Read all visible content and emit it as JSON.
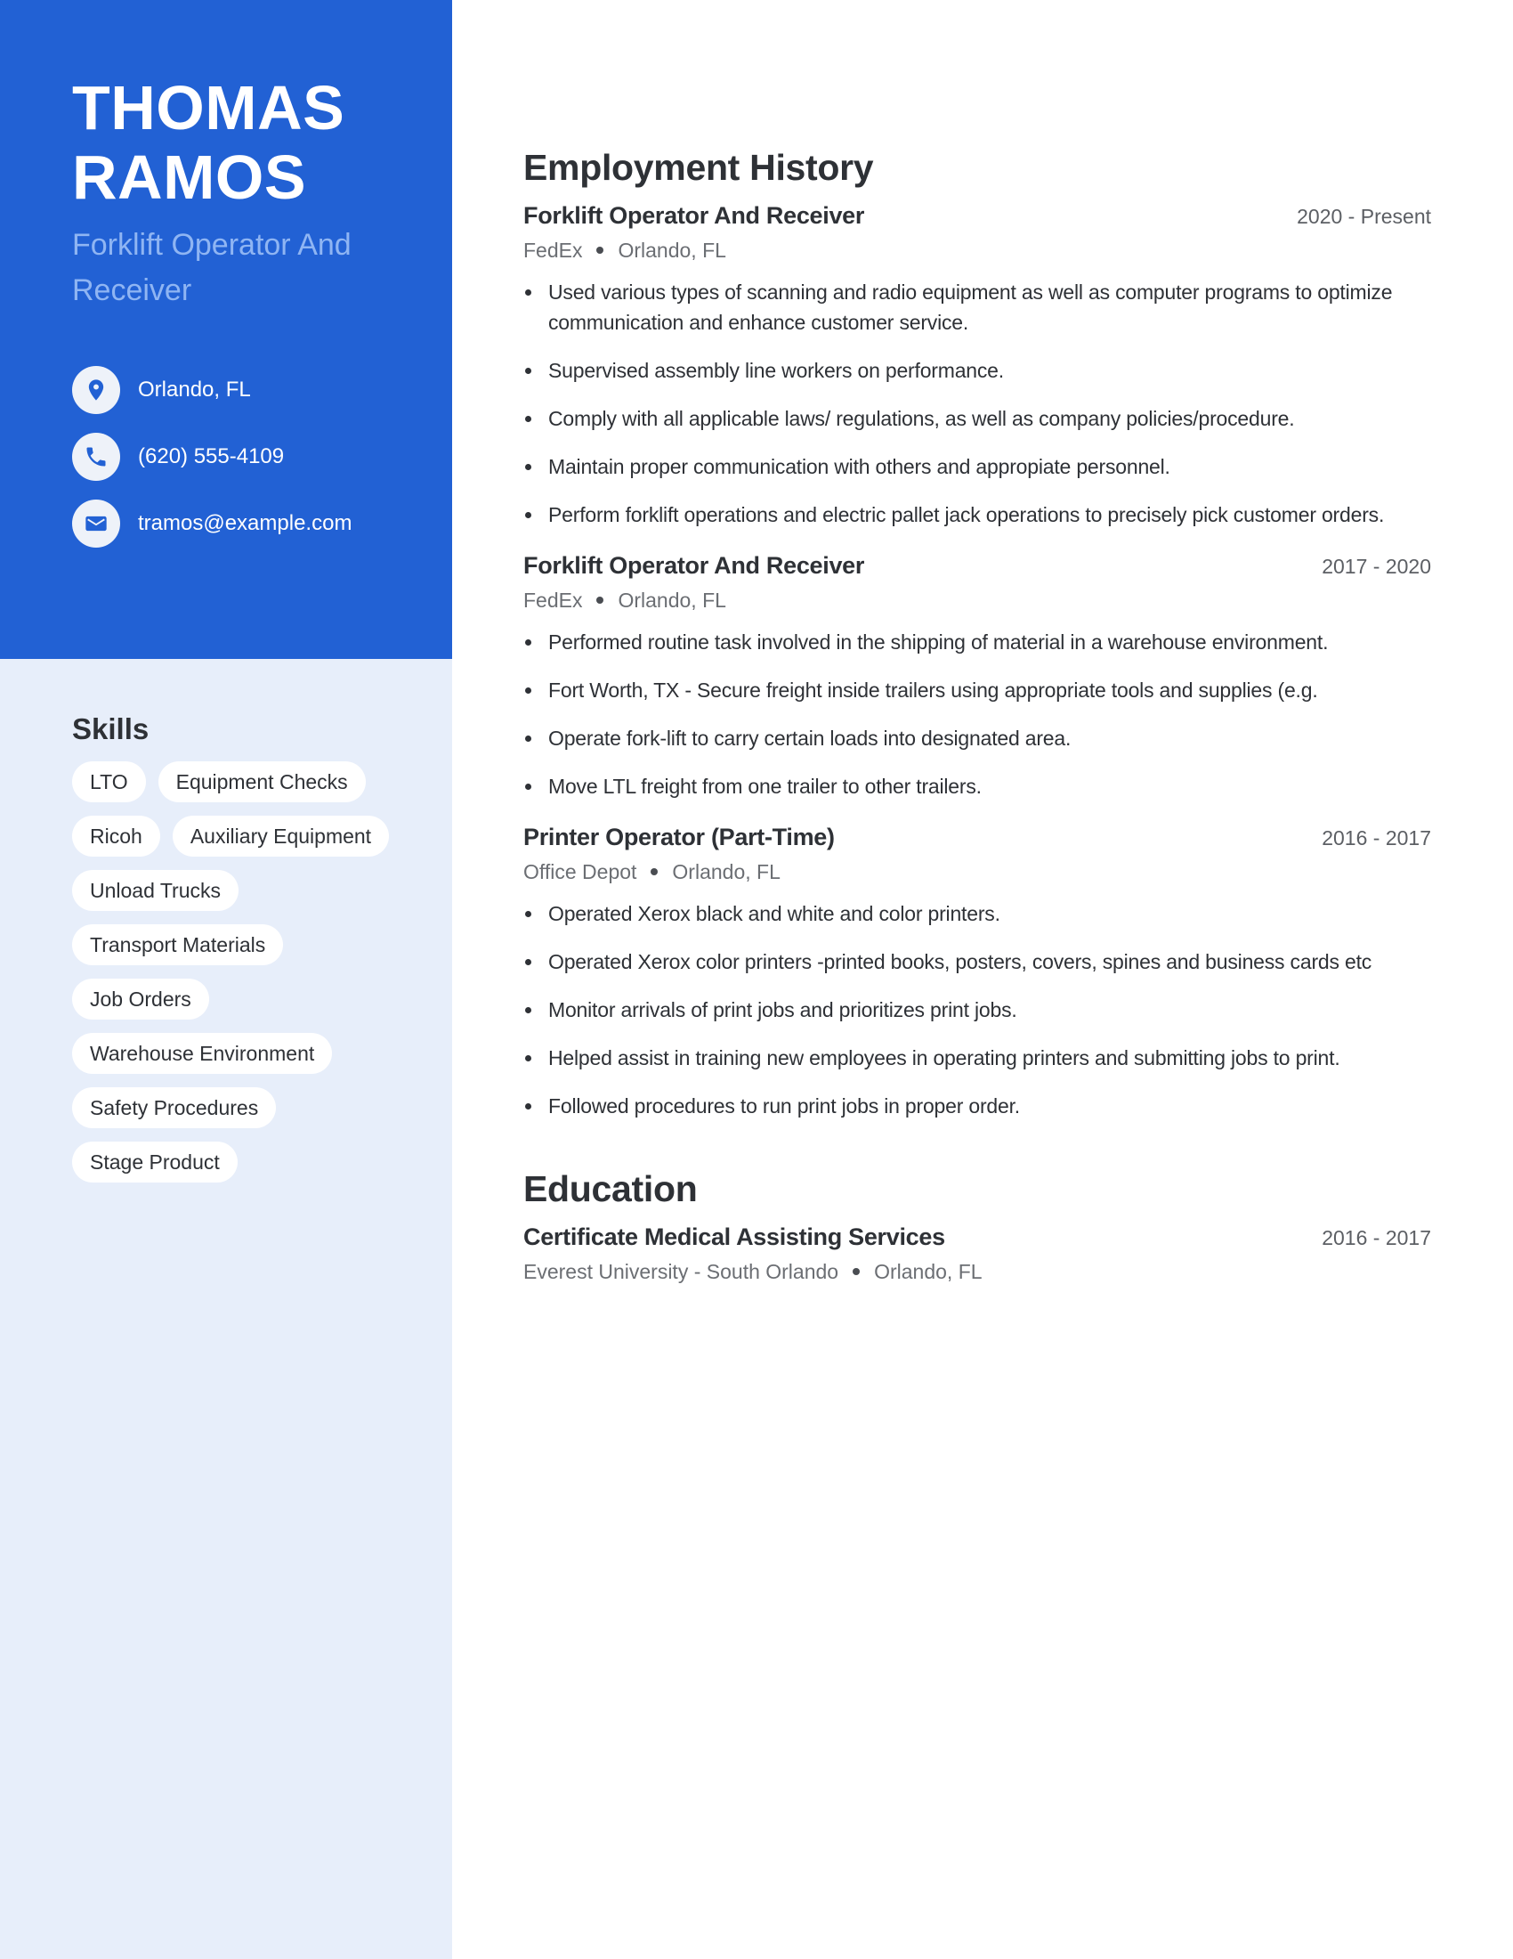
{
  "profile": {
    "name_line1": "THOMAS",
    "name_line2": "RAMOS",
    "title": "Forklift Operator And Receiver"
  },
  "contact": [
    {
      "icon": "location-pin-icon",
      "text": "Orlando, FL"
    },
    {
      "icon": "phone-icon",
      "text": "(620) 555-4109"
    },
    {
      "icon": "envelope-icon",
      "text": "tramos@example.com"
    }
  ],
  "skills": {
    "title": "Skills",
    "items": [
      "LTO",
      "Equipment Checks",
      "Ricoh",
      "Auxiliary Equipment",
      "Unload Trucks",
      "Transport Materials",
      "Job Orders",
      "Warehouse Environment",
      "Safety Procedures",
      "Stage Product"
    ]
  },
  "employment": {
    "title": "Employment History",
    "jobs": [
      {
        "title": "Forklift Operator And Receiver",
        "dates": "2020 - Present",
        "company": "FedEx",
        "location": "Orlando, FL",
        "bullets": [
          "Used various types of scanning and radio equipment as well as computer programs to optimize communication and enhance customer service.",
          "Supervised assembly line workers on performance.",
          "Comply with all applicable laws/ regulations, as well as company policies/procedure.",
          "Maintain proper communication with others and appropiate personnel.",
          "Perform forklift operations and electric pallet jack operations to precisely pick customer orders."
        ]
      },
      {
        "title": "Forklift Operator And Receiver",
        "dates": "2017 - 2020",
        "company": "FedEx",
        "location": "Orlando, FL",
        "bullets": [
          "Performed routine task involved in the shipping of material in a warehouse environment.",
          "Fort Worth, TX - Secure freight inside trailers using appropriate tools and supplies (e.g.",
          "Operate fork-lift to carry certain loads into designated area.",
          "Move LTL freight from one trailer to other trailers."
        ]
      },
      {
        "title": "Printer Operator (Part-Time)",
        "dates": "2016 - 2017",
        "company": "Office Depot",
        "location": "Orlando, FL",
        "bullets": [
          "Operated Xerox black and white and color printers.",
          "Operated Xerox color printers -printed books, posters, covers, spines and business cards etc",
          "Monitor arrivals of print jobs and prioritizes print jobs.",
          "Helped assist in training new employees in operating printers and submitting jobs to print.",
          "Followed procedures to run print jobs in proper order."
        ]
      }
    ]
  },
  "education": {
    "title": "Education",
    "items": [
      {
        "title": "Certificate Medical Assisting Services",
        "dates": "2016 - 2017",
        "school": "Everest University - South Orlando",
        "location": "Orlando, FL"
      }
    ]
  },
  "colors": {
    "accent": "#2261d4",
    "sidebar_bg": "#e7eefa",
    "subtitle": "#8fb5f3",
    "text": "#2e3136"
  }
}
